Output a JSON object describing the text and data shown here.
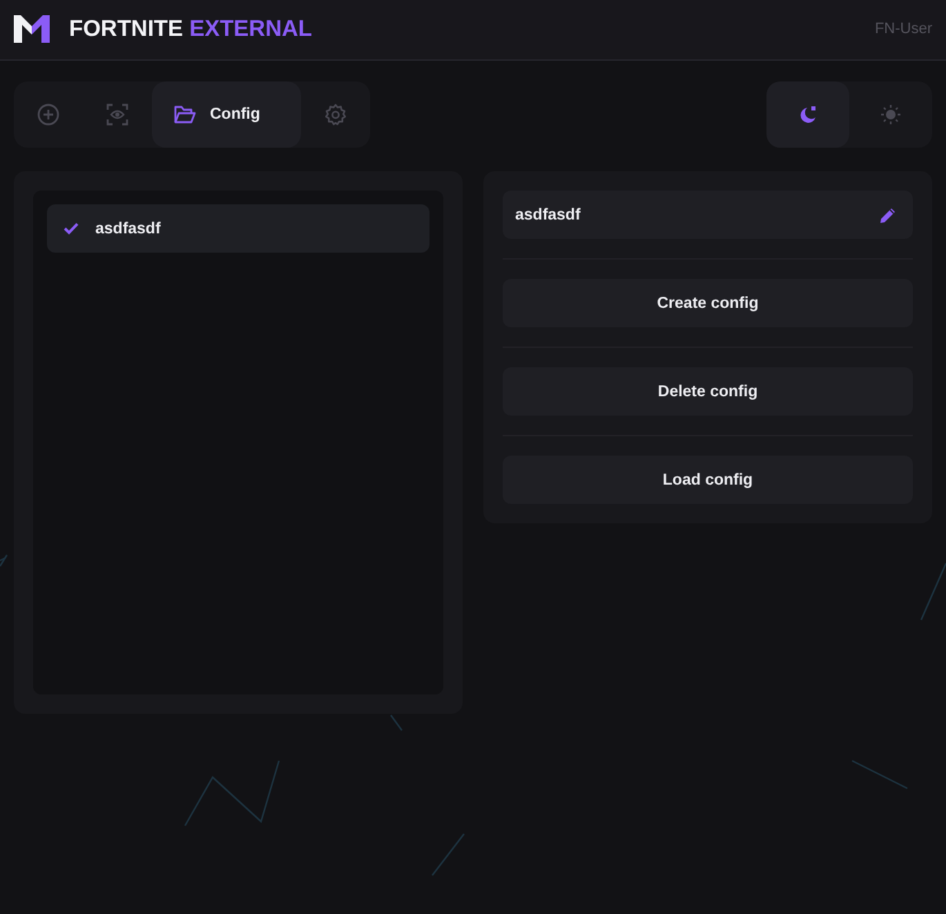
{
  "header": {
    "title": "FORTNITE",
    "title_accent": "EXTERNAL",
    "user": "FN-User"
  },
  "tabs": [
    {
      "kind": "aim",
      "selected": false
    },
    {
      "kind": "visuals",
      "selected": false
    },
    {
      "kind": "config",
      "label": "Config",
      "selected": true
    },
    {
      "kind": "settings",
      "selected": false
    }
  ],
  "theme_switch": [
    {
      "kind": "dark",
      "selected": true
    },
    {
      "kind": "light",
      "selected": false
    }
  ],
  "config_list": [
    {
      "name": "asdfasdf",
      "selected": true
    }
  ],
  "config_name": {
    "value": "asdfasdf"
  },
  "actions": [
    "Create config",
    "Delete config",
    "Load config"
  ]
}
